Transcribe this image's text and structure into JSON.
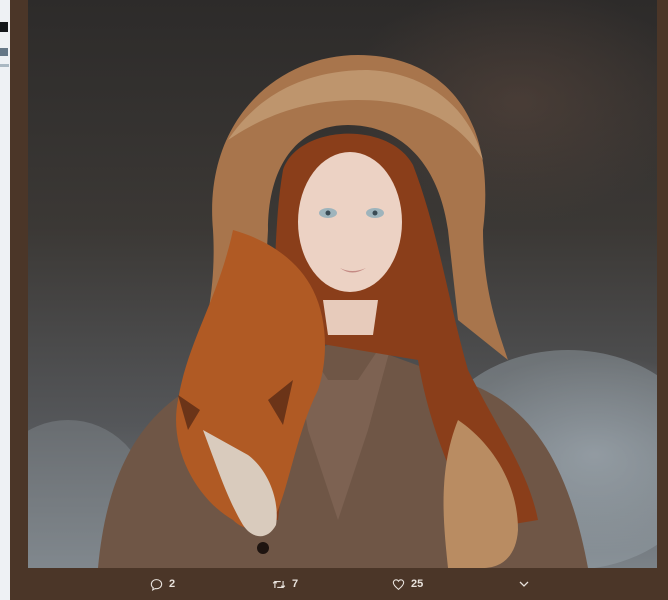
{
  "tweet": {
    "actions": {
      "reply_count": "2",
      "retweet_count": "7",
      "like_count": "25"
    },
    "icons": {
      "reply": "reply-icon",
      "retweet": "retweet-icon",
      "like": "heart-icon",
      "more": "chevron-down-icon"
    }
  },
  "colors": {
    "frame": "#4b3628",
    "action_text": "#e9e3dd"
  }
}
